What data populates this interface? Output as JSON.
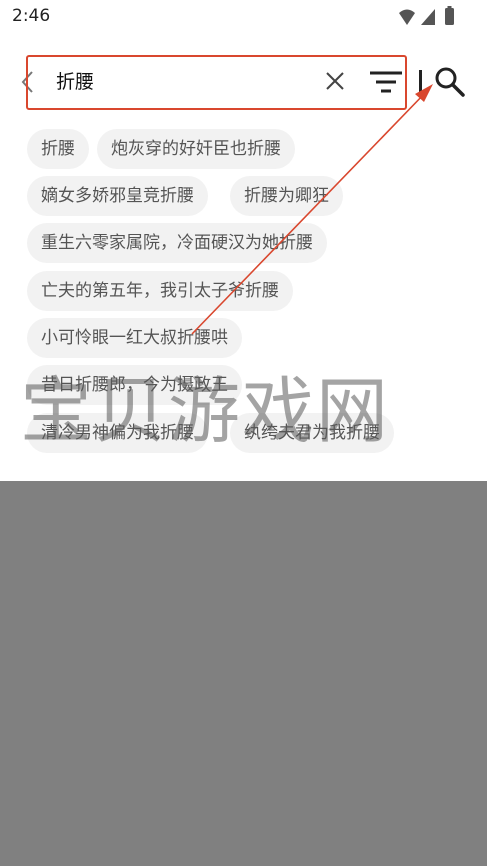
{
  "status_bar": {
    "time": "2:46"
  },
  "search": {
    "query": "折腰"
  },
  "history_tags": [
    "折腰",
    "炮灰穿的好奸臣也折腰",
    "嫡女多娇邪皇竞折腰",
    "折腰为卿狂",
    "重生六零家属院，冷面硬汉为她折腰",
    "亡夫的第五年，我引太子爷折腰",
    "小可怜眼一红大叔折腰哄",
    "昔日折腰郎，今为摄政王",
    "清冷男神偏为我折腰",
    "纨绔夫君为我折腰"
  ],
  "watermark": "宝贝游戏网",
  "colors": {
    "annotation": "#d9472e",
    "overlay": "#808080",
    "tag_bg": "#f2f2f2"
  }
}
